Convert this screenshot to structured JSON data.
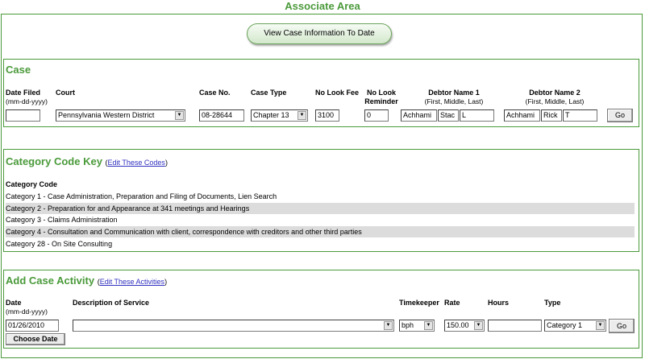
{
  "page_title": "Associate Area",
  "view_button_label": "View Case Information To Date",
  "case": {
    "title": "Case",
    "headers": {
      "date_filed": "Date Filed",
      "date_filed_format": "(mm-dd-yyyy)",
      "court": "Court",
      "case_no": "Case No.",
      "case_type": "Case Type",
      "no_look_fee": "No Look Fee",
      "no_look_reminder_1": "No Look",
      "no_look_reminder_2": "Reminder",
      "debtor1": "Debtor Name 1",
      "debtor1_sub": "(First, Middle, Last)",
      "debtor2": "Debtor Name 2",
      "debtor2_sub": "(First, Middle, Last)"
    },
    "values": {
      "date_filed": "",
      "court": "Pennsylvania Western District",
      "case_no": "08-28644",
      "case_type": "Chapter 13",
      "no_look_fee": "3100",
      "no_look_reminder": "0",
      "debtor1_first": "Achhami",
      "debtor1_middle": "Stac",
      "debtor1_last": "L",
      "debtor2_first": "Achhami",
      "debtor2_middle": "Rick",
      "debtor2_last": "T"
    },
    "go_label": "Go"
  },
  "category_key": {
    "title": "Category Code Key",
    "edit_open": "(",
    "edit_link": "Edit These Codes",
    "edit_close": ")",
    "header": "Category Code",
    "items": [
      "Category 1 - Case Administration, Preparation and Filing of Documents, Lien Search",
      "Category 2 - Preparation for and Appearance at 341 meetings and Hearings",
      "Category 3 - Claims Administration",
      "Category 4 - Consultation and Communication with client, correspondence with creditors and other third parties",
      "Category 28 - On Site Consulting"
    ]
  },
  "activity": {
    "title": "Add Case Activity",
    "edit_open": "(",
    "edit_link": "Edit These Activities",
    "edit_close": ")",
    "headers": {
      "date": "Date",
      "date_format": "(mm-dd-yyyy)",
      "description": "Description of Service",
      "timekeeper": "Timekeeper",
      "rate": "Rate",
      "hours": "Hours",
      "type": "Type"
    },
    "values": {
      "date": "01/26/2010",
      "description": "",
      "timekeeper": "bph",
      "rate": "150.00",
      "hours": "",
      "type": "Category 1"
    },
    "choose_date_label": "Choose Date",
    "go_label": "Go"
  },
  "colors": {
    "accent_green": "#4a9a3a",
    "row_shade": "#dcdcdc",
    "link_blue": "#3030c0"
  },
  "icons": {
    "dropdown": "▼"
  }
}
